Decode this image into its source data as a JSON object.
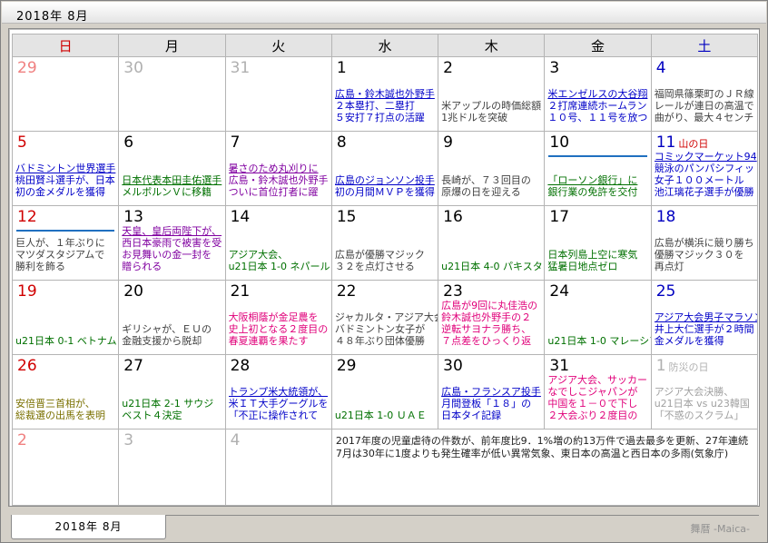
{
  "window": {
    "title": "2018年 8月"
  },
  "weekdays": [
    "日",
    "月",
    "火",
    "水",
    "木",
    "金",
    "土"
  ],
  "weeks": [
    [
      {
        "day": "29",
        "other": true,
        "news": []
      },
      {
        "day": "30",
        "other": true,
        "news": []
      },
      {
        "day": "31",
        "other": true,
        "news": []
      },
      {
        "day": "1",
        "news": [
          {
            "text": "広島・鈴木誠也外野手",
            "color": "blue",
            "underline": true
          },
          {
            "text": "２本塁打、二塁打",
            "color": "blue"
          },
          {
            "text": "５安打７打点の活躍",
            "color": "blue"
          }
        ]
      },
      {
        "day": "2",
        "news": [
          {
            "text": "米アップルの時価総額",
            "color": "dark"
          },
          {
            "text": "1兆ドルを突破",
            "color": "dark"
          }
        ]
      },
      {
        "day": "3",
        "news": [
          {
            "text": "米エンゼルスの大谷翔",
            "color": "blue",
            "underline": true
          },
          {
            "text": "２打席連続ホームラン",
            "color": "blue"
          },
          {
            "text": "１０号、１１号を放つ",
            "color": "blue"
          }
        ]
      },
      {
        "day": "4",
        "news": [
          {
            "text": "福岡県篠栗町のＪＲ線",
            "color": "dark"
          },
          {
            "text": "レールが連日の高温で",
            "color": "dark"
          },
          {
            "text": "曲がり、最大４センチ",
            "color": "dark"
          }
        ]
      }
    ],
    [
      {
        "day": "5",
        "news": [
          {
            "text": "バドミントン世界選手",
            "color": "blue",
            "underline": true
          },
          {
            "text": "桃田賢斗選手が、日本",
            "color": "blue"
          },
          {
            "text": "初の金メダルを獲得",
            "color": "blue"
          }
        ]
      },
      {
        "day": "6",
        "news": [
          {
            "text": "日本代表本田圭佑選手",
            "color": "green",
            "underline": true
          },
          {
            "text": "メルボルンＶに移籍",
            "color": "green"
          }
        ]
      },
      {
        "day": "7",
        "news": [
          {
            "text": "暑さのため丸刈りに",
            "color": "purple",
            "underline": true
          },
          {
            "text": "広島・鈴木誠也外野手",
            "color": "purple"
          },
          {
            "text": "ついに首位打者に躍",
            "color": "purple"
          }
        ]
      },
      {
        "day": "8",
        "news": [
          {
            "text": "広島のジョンソン投手",
            "color": "blue",
            "underline": true
          },
          {
            "text": "初の月間ＭＶＰを獲得",
            "color": "blue"
          }
        ]
      },
      {
        "day": "9",
        "news": [
          {
            "text": "長崎が、７３回目の",
            "color": "dark"
          },
          {
            "text": "原爆の日を迎える",
            "color": "dark"
          }
        ]
      },
      {
        "day": "10",
        "bar": true,
        "news": [
          {
            "text": "「ローソン銀行」に",
            "color": "green",
            "underline": true
          },
          {
            "text": "銀行業の免許を交付",
            "color": "green"
          }
        ]
      },
      {
        "day": "11",
        "holiday": "山の日",
        "news": [
          {
            "text": "コミックマーケット94",
            "color": "blue",
            "underline": true
          },
          {
            "text": "競泳のパンパシフィッ",
            "color": "blue"
          },
          {
            "text": "女子１００メートル",
            "color": "blue"
          },
          {
            "text": "池江璃花子選手が優勝",
            "color": "blue"
          }
        ]
      }
    ],
    [
      {
        "day": "12",
        "bar": true,
        "news": [
          {
            "text": "巨人が、１年ぶりに",
            "color": "dark"
          },
          {
            "text": "マツダスタジアムで",
            "color": "dark"
          },
          {
            "text": "勝利を飾る",
            "color": "dark"
          }
        ]
      },
      {
        "day": "13",
        "news": [
          {
            "text": "天皇、皇后両陛下が、",
            "color": "purple",
            "underline": true
          },
          {
            "text": "西日本豪雨で被害を受",
            "color": "purple"
          },
          {
            "text": "お見舞いの金一封を",
            "color": "purple"
          },
          {
            "text": "贈られる",
            "color": "purple"
          }
        ]
      },
      {
        "day": "14",
        "news": [
          {
            "text": "アジア大会、",
            "color": "green"
          },
          {
            "text": "u21日本 1-0 ネパール",
            "color": "green"
          }
        ]
      },
      {
        "day": "15",
        "news": [
          {
            "text": "広島が優勝マジック",
            "color": "dark"
          },
          {
            "text": "３２を点灯させる",
            "color": "dark"
          }
        ]
      },
      {
        "day": "16",
        "news": [
          {
            "text": "u21日本 4-0 パキスタン",
            "color": "green"
          }
        ]
      },
      {
        "day": "17",
        "news": [
          {
            "text": "日本列島上空に寒気",
            "color": "green"
          },
          {
            "text": "猛暑日地点ゼロ",
            "color": "green"
          }
        ]
      },
      {
        "day": "18",
        "news": [
          {
            "text": "広島が横浜に競り勝ち",
            "color": "dark"
          },
          {
            "text": "優勝マジック３０を",
            "color": "dark"
          },
          {
            "text": "再点灯",
            "color": "dark"
          }
        ]
      }
    ],
    [
      {
        "day": "19",
        "news": [
          {
            "text": "u21日本 0-1 ベトナム",
            "color": "green"
          }
        ]
      },
      {
        "day": "20",
        "news": [
          {
            "text": "ギリシャが、ＥＵの",
            "color": "dark"
          },
          {
            "text": "金融支援から脱却",
            "color": "dark"
          }
        ]
      },
      {
        "day": "21",
        "news": [
          {
            "text": "大阪桐蔭が金足農を",
            "color": "magenta"
          },
          {
            "text": "史上初となる２度目の",
            "color": "magenta"
          },
          {
            "text": "春夏連覇を果たす",
            "color": "magenta"
          }
        ]
      },
      {
        "day": "22",
        "news": [
          {
            "text": "ジャカルタ・アジア大会",
            "color": "dark"
          },
          {
            "text": "バドミントン女子が",
            "color": "dark"
          },
          {
            "text": "４８年ぶり団体優勝",
            "color": "dark"
          }
        ]
      },
      {
        "day": "23",
        "news": [
          {
            "text": "広島が9回に丸佳浩の",
            "color": "magenta"
          },
          {
            "text": "鈴木誠也外野手の２",
            "color": "magenta"
          },
          {
            "text": "逆転サヨナラ勝ち、",
            "color": "magenta"
          },
          {
            "text": "７点差をひっくり返",
            "color": "magenta"
          }
        ]
      },
      {
        "day": "24",
        "news": [
          {
            "text": "u21日本 1-0 マレーシア",
            "color": "green"
          }
        ]
      },
      {
        "day": "25",
        "news": [
          {
            "text": "アジア大会男子マラソン",
            "color": "blue",
            "underline": true
          },
          {
            "text": "井上大仁選手が２時間",
            "color": "blue"
          },
          {
            "text": "金メダルを獲得",
            "color": "blue"
          }
        ]
      }
    ],
    [
      {
        "day": "26",
        "news": [
          {
            "text": "安倍晋三首相が、",
            "color": "olive"
          },
          {
            "text": "総裁選の出馬を表明",
            "color": "olive"
          }
        ]
      },
      {
        "day": "27",
        "news": [
          {
            "text": "u21日本 2-1 サウジ",
            "color": "green"
          },
          {
            "text": "ベスト４決定",
            "color": "green"
          }
        ]
      },
      {
        "day": "28",
        "news": [
          {
            "text": "トランプ米大統領が、",
            "color": "blue",
            "underline": true
          },
          {
            "text": "米ＩＴ大手グーグルを",
            "color": "blue"
          },
          {
            "text": "「不正に操作されて",
            "color": "blue"
          }
        ]
      },
      {
        "day": "29",
        "news": [
          {
            "text": "u21日本 1-0 ＵＡＥ",
            "color": "green"
          }
        ]
      },
      {
        "day": "30",
        "news": [
          {
            "text": "広島・フランスア投手",
            "color": "blue",
            "underline": true
          },
          {
            "text": "月間登板「１８」の",
            "color": "blue"
          },
          {
            "text": "日本タイ記録",
            "color": "blue"
          }
        ]
      },
      {
        "day": "31",
        "news": [
          {
            "text": "アジア大会、サッカー",
            "color": "magenta"
          },
          {
            "text": "なでしこジャパンが",
            "color": "magenta"
          },
          {
            "text": "中国を１－０で下し",
            "color": "magenta"
          },
          {
            "text": "２大会ぶり２度目の",
            "color": "magenta"
          }
        ]
      },
      {
        "day": "1",
        "other": true,
        "holiday": "防災の日",
        "news": [
          {
            "text": "アジア大会決勝、",
            "color": "gray"
          },
          {
            "text": "u21日本 vs u23韓国",
            "color": "gray"
          },
          {
            "text": "「不惑のスクラム」",
            "color": "gray"
          }
        ]
      }
    ],
    [
      {
        "day": "2",
        "other": true,
        "news": []
      },
      {
        "day": "3",
        "other": true,
        "news": []
      },
      {
        "day": "4",
        "other": true,
        "news": []
      }
    ]
  ],
  "summary": {
    "line1": "2017年度の児童虐待の件数が、前年度比9．1%増の約13万件で過去最多を更新、27年連続",
    "line2": "7月は30年に1度よりも発生確率が低い異常気象、東日本の高温と西日本の多雨(気象庁)"
  },
  "tab": {
    "label": "2018年 8月"
  },
  "brand": "舞暦 -Maica-"
}
